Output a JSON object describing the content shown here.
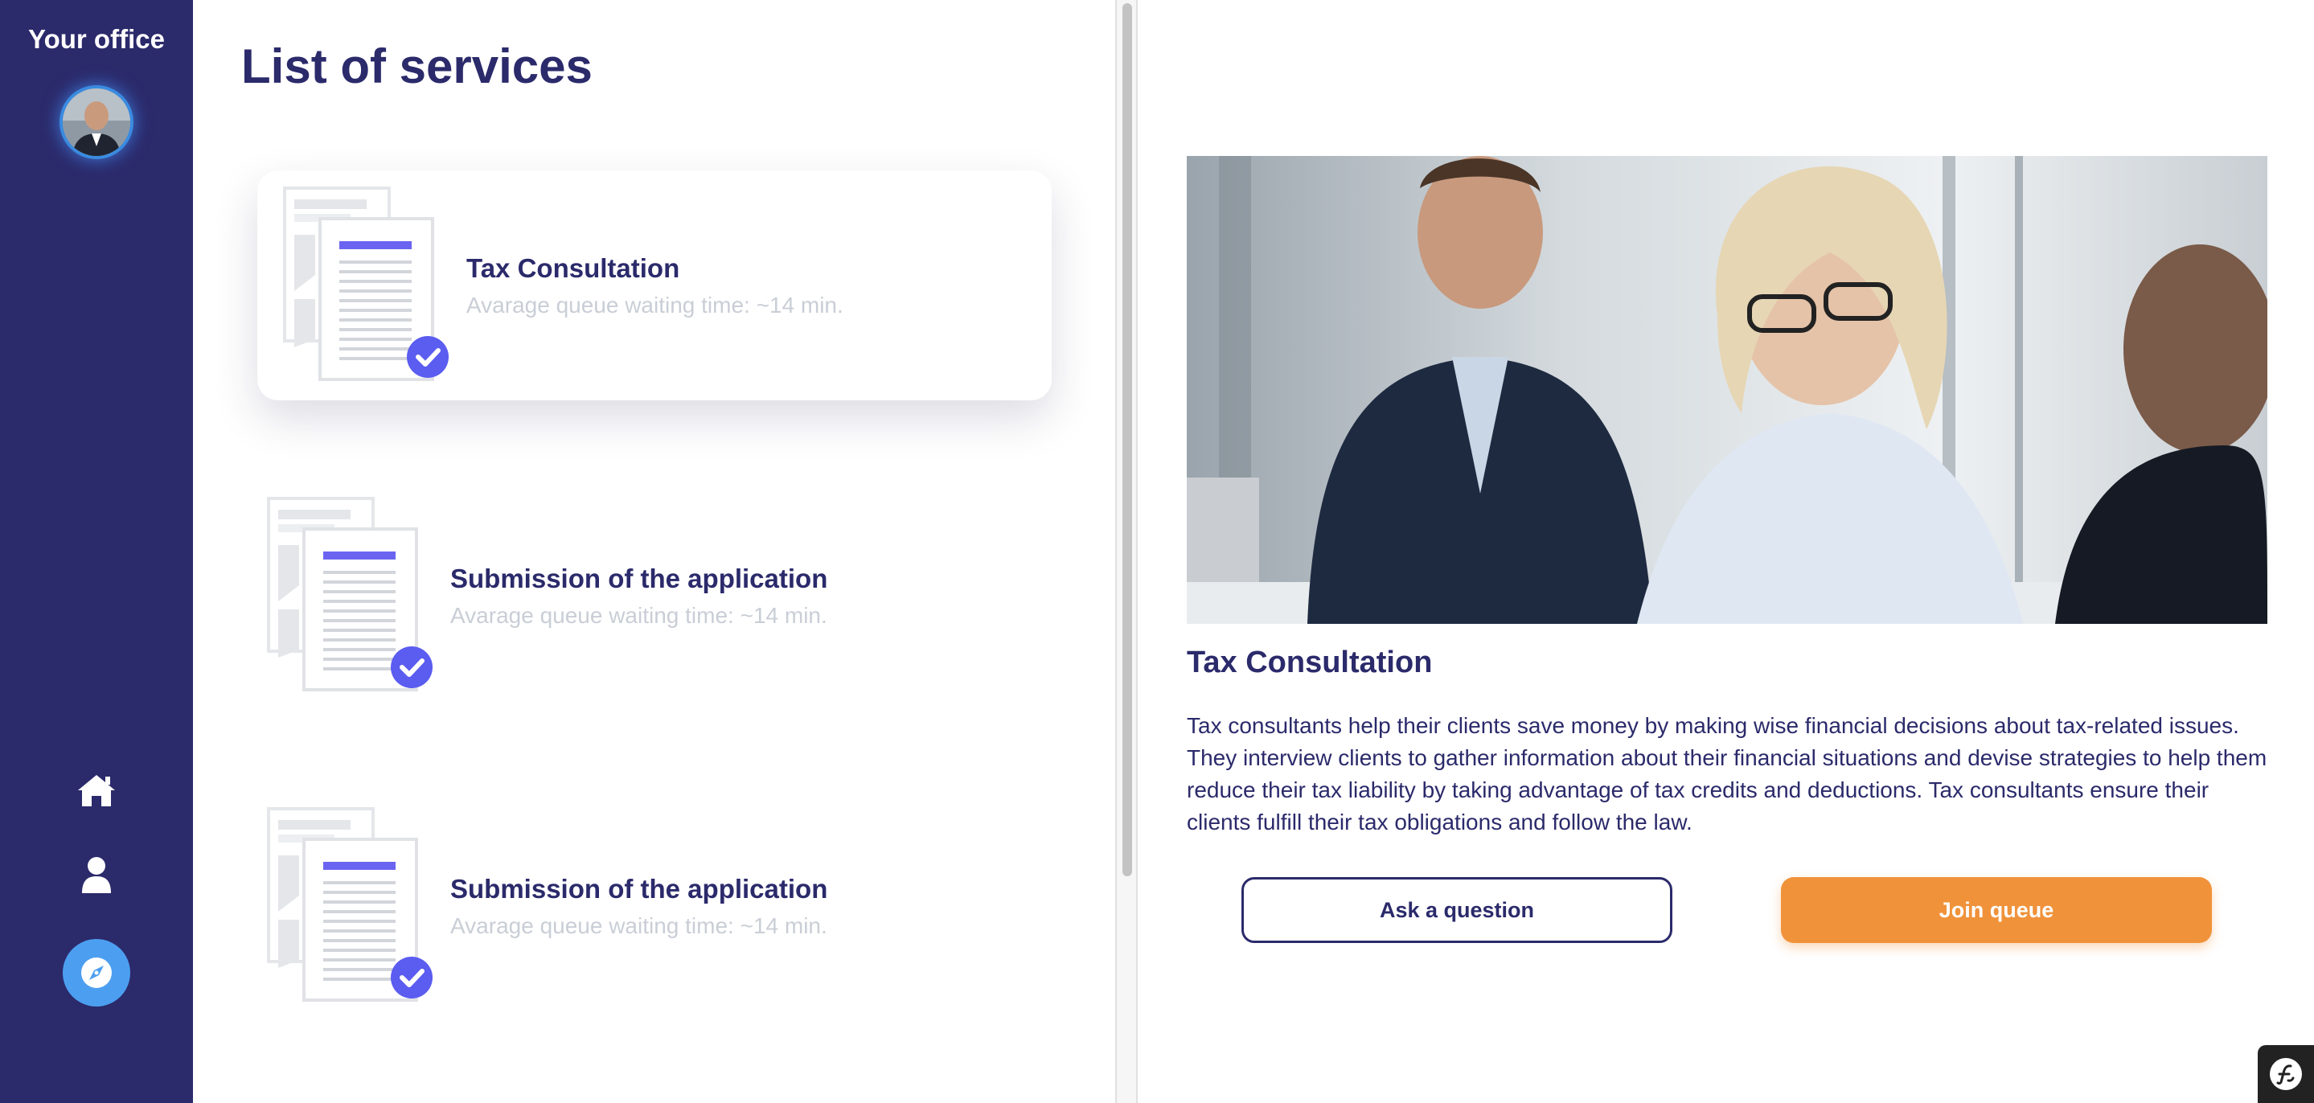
{
  "sidebar": {
    "title": "Your office",
    "nav": [
      {
        "name": "home",
        "icon": "home-icon"
      },
      {
        "name": "profile",
        "icon": "user-icon"
      },
      {
        "name": "explore",
        "icon": "compass-icon",
        "active": true
      }
    ]
  },
  "services": {
    "title": "List of services",
    "items": [
      {
        "name": "Tax Consultation",
        "wait": "Avarage queue waiting time: ~14 min.",
        "selected": true
      },
      {
        "name": "Submission of the application",
        "wait": "Avarage queue waiting time: ~14 min.",
        "selected": false
      },
      {
        "name": "Submission of the application",
        "wait": "Avarage queue waiting time: ~14 min.",
        "selected": false
      }
    ]
  },
  "detail": {
    "title": "Tax Consultation",
    "description": "Tax consultants help their clients save money by making wise financial decisions about tax-related issues. They interview clients to gather information about their financial situations and devise strategies to help them reduce their tax liability by taking advantage of tax credits and deductions. Tax consultants ensure their clients fulfill their tax obligations and follow the law.",
    "ask_label": "Ask a question",
    "join_label": "Join queue"
  },
  "colors": {
    "sidebar_bg": "#2b2a6b",
    "accent": "#5b5cf0",
    "primary_text": "#2b2a6b",
    "muted_text": "#c9ced6",
    "join_button": "#f0923a",
    "active_nav": "#4c9ff0"
  }
}
